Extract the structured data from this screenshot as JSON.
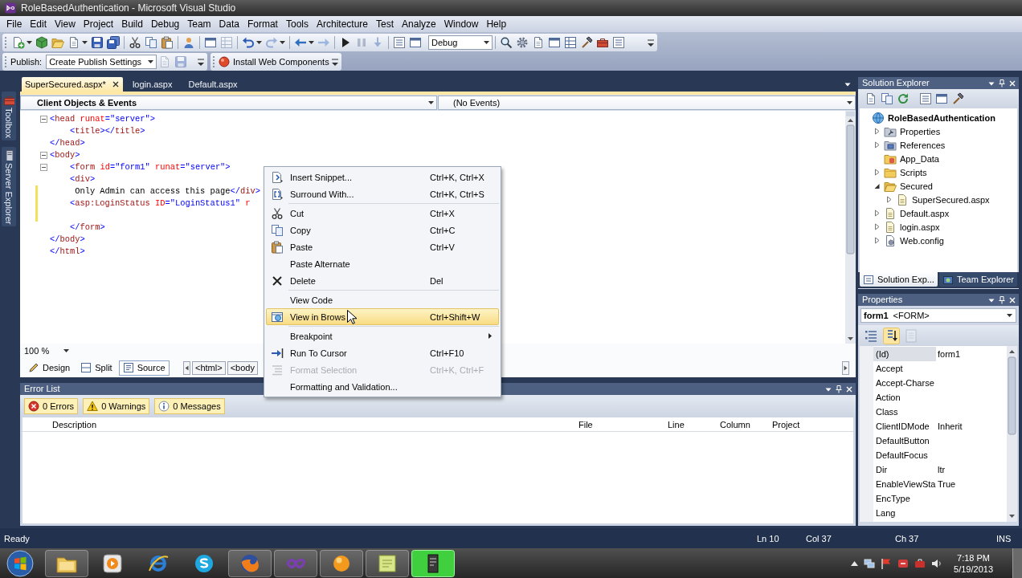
{
  "window": {
    "title": "RoleBasedAuthentication - Microsoft Visual Studio"
  },
  "menu_bar": [
    "File",
    "Edit",
    "View",
    "Project",
    "Build",
    "Debug",
    "Team",
    "Data",
    "Format",
    "Tools",
    "Architecture",
    "Test",
    "Analyze",
    "Window",
    "Help"
  ],
  "standard_toolbar": {
    "configuration": "Debug"
  },
  "publish_toolbar": {
    "label": "Publish:",
    "profile": "Create Publish Settings",
    "install_button": "Install Web Components"
  },
  "side_tabs": [
    "Toolbox",
    "Server Explorer"
  ],
  "document_tabs": [
    {
      "label": "SuperSecured.aspx*",
      "selected": true
    },
    {
      "label": "login.aspx",
      "selected": false
    },
    {
      "label": "Default.aspx",
      "selected": false
    }
  ],
  "editor": {
    "object_list": "Client Objects & Events",
    "event_list": "(No Events)",
    "lines": [
      {
        "text": "<head runat=\"server\">",
        "fold": true,
        "changed": false
      },
      {
        "text": "    <title></title>",
        "fold": false,
        "changed": false
      },
      {
        "text": "</head>",
        "fold": false,
        "changed": false
      },
      {
        "text": "<body>",
        "fold": true,
        "changed": false
      },
      {
        "text": "    <form id=\"form1\" runat=\"server\">",
        "fold": true,
        "changed": false
      },
      {
        "text": "    <div>",
        "fold": false,
        "changed": false
      },
      {
        "text": "     Only Admin can access this page</div>",
        "fold": false,
        "changed": true
      },
      {
        "text": "    <asp:LoginStatus ID=\"LoginStatus1\" r",
        "fold": false,
        "changed": true
      },
      {
        "fold": false,
        "changed": true
      },
      {
        "text": "    </form>",
        "fold": false,
        "changed": false
      },
      {
        "text": "</body>",
        "fold": false,
        "changed": false
      },
      {
        "text": "</html>",
        "fold": false,
        "changed": false
      }
    ],
    "zoom": "100 %",
    "view_tabs": [
      {
        "label": "Design",
        "selected": false
      },
      {
        "label": "Split",
        "selected": false
      },
      {
        "label": "Source",
        "selected": true
      }
    ],
    "breadcrumbs": [
      "<html>",
      "<body"
    ]
  },
  "context_menu": {
    "items": [
      {
        "kind": "command",
        "label": "Insert Snippet...",
        "shortcut": "Ctrl+K, Ctrl+X",
        "selected": false,
        "disabled": false,
        "submenu": false
      },
      {
        "kind": "command",
        "label": "Surround With...",
        "shortcut": "Ctrl+K, Ctrl+S",
        "selected": false,
        "disabled": false,
        "submenu": false
      },
      {
        "kind": "separator"
      },
      {
        "kind": "command",
        "label": "Cut",
        "shortcut": "Ctrl+X",
        "selected": false,
        "disabled": false,
        "submenu": false
      },
      {
        "kind": "command",
        "label": "Copy",
        "shortcut": "Ctrl+C",
        "selected": false,
        "disabled": false,
        "submenu": false
      },
      {
        "kind": "command",
        "label": "Paste",
        "shortcut": "Ctrl+V",
        "selected": false,
        "disabled": false,
        "submenu": false
      },
      {
        "kind": "command",
        "label": "Paste Alternate",
        "selected": false,
        "disabled": false,
        "submenu": false
      },
      {
        "kind": "command",
        "label": "Delete",
        "shortcut": "Del",
        "selected": false,
        "disabled": false,
        "submenu": false
      },
      {
        "kind": "separator"
      },
      {
        "kind": "command",
        "label": "View Code",
        "selected": false,
        "disabled": false,
        "submenu": false
      },
      {
        "kind": "command",
        "label": "View in Brows",
        "shortcut": "Ctrl+Shift+W",
        "selected": true,
        "disabled": false,
        "submenu": false
      },
      {
        "kind": "separator"
      },
      {
        "kind": "command",
        "label": "Breakpoint",
        "selected": false,
        "disabled": false,
        "submenu": true
      },
      {
        "kind": "command",
        "label": "Run To Cursor",
        "shortcut": "Ctrl+F10",
        "selected": false,
        "disabled": false,
        "submenu": false
      },
      {
        "kind": "command",
        "label": "Format Selection",
        "shortcut": "Ctrl+K, Ctrl+F",
        "selected": false,
        "disabled": true,
        "submenu": false
      },
      {
        "kind": "command",
        "label": "Formatting and Validation...",
        "selected": false,
        "disabled": false,
        "submenu": false
      }
    ]
  },
  "error_list": {
    "title": "Error List",
    "filters": [
      {
        "label": "0 Errors",
        "on": true
      },
      {
        "label": "0 Warnings",
        "on": true
      },
      {
        "label": "0 Messages",
        "on": true
      }
    ],
    "columns": [
      "Description",
      "File",
      "Line",
      "Column",
      "Project"
    ]
  },
  "solution_explorer": {
    "title": "Solution Explorer",
    "tree": [
      {
        "label": "RoleBasedAuthentication",
        "kind": "project",
        "children": [
          {
            "label": "Properties",
            "kind": "properties",
            "expanded": false
          },
          {
            "label": "References",
            "kind": "references",
            "expanded": false
          },
          {
            "label": "App_Data",
            "kind": "data-folder"
          },
          {
            "label": "Scripts",
            "kind": "folder",
            "expanded": false
          },
          {
            "label": "Secured",
            "kind": "folder",
            "expanded": true,
            "children": [
              {
                "label": "SuperSecured.aspx",
                "kind": "page",
                "expanded": false
              }
            ]
          },
          {
            "label": "Default.aspx",
            "kind": "page",
            "expanded": false
          },
          {
            "label": "login.aspx",
            "kind": "page",
            "expanded": false
          },
          {
            "label": "Web.config",
            "kind": "config",
            "expanded": false
          }
        ]
      }
    ],
    "tabs": [
      {
        "label": "Solution Exp...",
        "selected": true
      },
      {
        "label": "Team Explorer",
        "selected": false
      }
    ]
  },
  "properties": {
    "title": "Properties",
    "object": "form1",
    "object_type": "<FORM>",
    "views": [
      {
        "selected": false,
        "disabled": false
      },
      {
        "selected": true,
        "disabled": false
      },
      {
        "selected": false,
        "disabled": true
      }
    ],
    "rows": [
      {
        "name": "(Id)",
        "value": "form1",
        "selected": true
      },
      {
        "name": "Accept",
        "selected": false
      },
      {
        "name": "Accept-Charse",
        "selected": false
      },
      {
        "name": "Action",
        "selected": false
      },
      {
        "name": "Class",
        "selected": false
      },
      {
        "name": "ClientIDMode",
        "value": "Inherit",
        "selected": false
      },
      {
        "name": "DefaultButton",
        "selected": false
      },
      {
        "name": "DefaultFocus",
        "selected": false
      },
      {
        "name": "Dir",
        "value": "ltr",
        "selected": false
      },
      {
        "name": "EnableViewSta",
        "value": "True",
        "selected": false
      },
      {
        "name": "EncType",
        "selected": false
      },
      {
        "name": "Lang",
        "selected": false
      }
    ]
  },
  "status_bar": {
    "message": "Ready",
    "line": "Ln 10",
    "column": "Col 37",
    "character": "Ch 37",
    "mode": "INS"
  },
  "taskbar": {
    "apps": [
      {
        "running": true,
        "highlighted": false
      },
      {
        "running": false,
        "highlighted": false
      },
      {
        "running": false,
        "highlighted": false
      },
      {
        "running": false,
        "highlighted": false
      },
      {
        "running": true,
        "highlighted": false
      },
      {
        "running": true,
        "highlighted": false
      },
      {
        "running": true,
        "highlighted": false
      },
      {
        "running": true,
        "highlighted": false
      },
      {
        "running": true,
        "highlighted": true
      }
    ],
    "clock": {
      "time": "7:18 PM",
      "date": "5/19/2013"
    }
  }
}
